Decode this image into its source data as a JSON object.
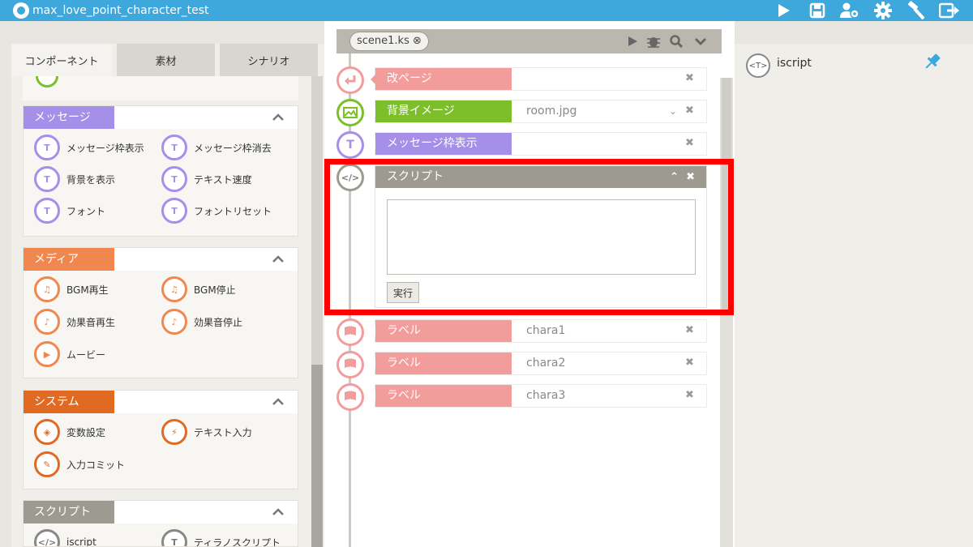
{
  "app": {
    "title": "max_love_point_character_test"
  },
  "toolbar": {
    "icons": [
      "play-icon",
      "save-icon",
      "users-gear-icon",
      "settings-icon",
      "build-icon",
      "export-icon"
    ]
  },
  "left_tabs": [
    "コンポーネント",
    "素材",
    "シナリオ"
  ],
  "groups": {
    "message": {
      "label": "メッセージ",
      "color": "#a58fe8",
      "items": [
        "メッセージ枠表示",
        "メッセージ枠消去",
        "背景を表示",
        "テキスト速度",
        "フォント",
        "フォントリセット"
      ]
    },
    "media": {
      "label": "メディア",
      "color": "#f0874e",
      "items": [
        "BGM再生",
        "BGM停止",
        "効果音再生",
        "効果音停止",
        "ムービー"
      ]
    },
    "system": {
      "label": "システム",
      "color": "#e16a23",
      "items": [
        "変数設定",
        "テキスト入力",
        "入力コミット"
      ]
    },
    "script": {
      "label": "スクリプト",
      "color": "#9d9a92",
      "items": [
        "iscript",
        "ティラノスクリプト"
      ]
    }
  },
  "scene": {
    "tab_label": "scene1.ks",
    "close_glyph": "⊗"
  },
  "rows": [
    {
      "label": "改ページ",
      "value": "",
      "color": "#f29c9c"
    },
    {
      "label": "背景イメージ",
      "value": "room.jpg",
      "color": "#7cbf2a"
    },
    {
      "label": "メッセージ枠表示",
      "value": "",
      "color": "#a58fe8"
    },
    {
      "label": "ラベル",
      "value": "chara1",
      "color": "#f29c9c"
    },
    {
      "label": "ラベル",
      "value": "chara2",
      "color": "#f29c9c"
    },
    {
      "label": "ラベル",
      "value": "chara3",
      "color": "#f29c9c"
    }
  ],
  "script_block": {
    "title": "スクリプト",
    "run_label": "実行",
    "code": ""
  },
  "right": {
    "label": "iscript",
    "icon_text": "<T>"
  },
  "highlight_color": "#ff0000"
}
